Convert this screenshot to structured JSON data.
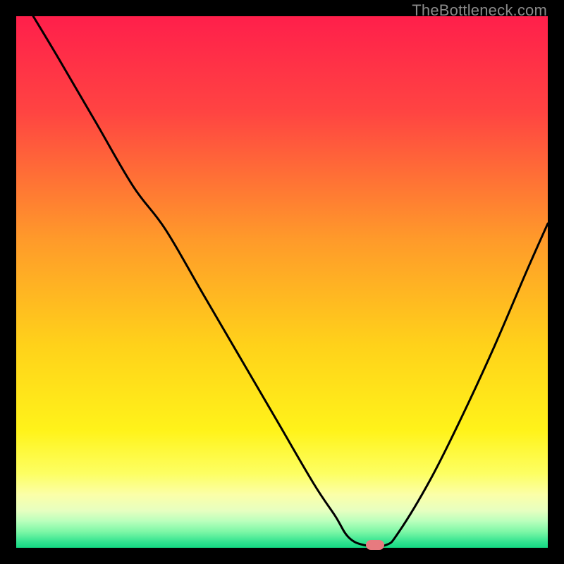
{
  "watermark": "TheBottleneck.com",
  "chart_data": {
    "type": "line",
    "title": "",
    "xlabel": "",
    "ylabel": "",
    "xlim": [
      0,
      100
    ],
    "ylim": [
      0,
      100
    ],
    "grid": false,
    "legend": false,
    "series": [
      {
        "name": "curve",
        "x": [
          3.2,
          8,
          15,
          22,
          28,
          35,
          42,
          49,
          56,
          60,
          62.5,
          65.5,
          69.5,
          72,
          78,
          84,
          90,
          96,
          100
        ],
        "y": [
          100,
          92,
          80,
          68,
          60,
          48,
          36,
          24,
          12,
          6,
          2,
          0.5,
          0.5,
          3,
          13,
          25,
          38,
          52,
          61
        ]
      }
    ],
    "marker": {
      "x": 67.5,
      "y": 0.5
    },
    "gradient_stops": [
      {
        "offset": 0,
        "color": "#ff1f4b"
      },
      {
        "offset": 18,
        "color": "#ff4442"
      },
      {
        "offset": 42,
        "color": "#ff9a2a"
      },
      {
        "offset": 62,
        "color": "#ffd21a"
      },
      {
        "offset": 78,
        "color": "#fff31a"
      },
      {
        "offset": 86,
        "color": "#fdff62"
      },
      {
        "offset": 90,
        "color": "#fbffa8"
      },
      {
        "offset": 93,
        "color": "#e7ffc0"
      },
      {
        "offset": 95,
        "color": "#b9ffbc"
      },
      {
        "offset": 97,
        "color": "#7cf7a6"
      },
      {
        "offset": 99,
        "color": "#2fe28f"
      },
      {
        "offset": 100,
        "color": "#14d983"
      }
    ]
  }
}
